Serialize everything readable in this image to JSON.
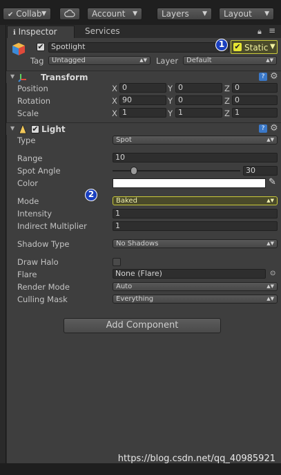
{
  "toolbar": {
    "collab_label": "Collab",
    "account_label": "Account",
    "layers_label": "Layers",
    "layout_label": "Layout"
  },
  "tabs": {
    "inspector": "Inspector",
    "services": "Services"
  },
  "object": {
    "name": "Spotlight",
    "active": true,
    "static_label": "Static",
    "static_checked": true,
    "tag_label": "Tag",
    "tag_value": "Untagged",
    "layer_label": "Layer",
    "layer_value": "Default"
  },
  "transform": {
    "title": "Transform",
    "position_label": "Position",
    "rotation_label": "Rotation",
    "scale_label": "Scale",
    "axis_x": "X",
    "axis_y": "Y",
    "axis_z": "Z",
    "position": [
      "0",
      "0",
      "0"
    ],
    "rotation": [
      "90",
      "0",
      "0"
    ],
    "scale": [
      "1",
      "1",
      "1"
    ]
  },
  "light": {
    "title": "Light",
    "type_label": "Type",
    "type_value": "Spot",
    "range_label": "Range",
    "range_value": "10",
    "spot_angle_label": "Spot Angle",
    "spot_angle_value": "30",
    "spot_angle_fraction": 0.17,
    "color_label": "Color",
    "color_value": "#ffffff",
    "mode_label": "Mode",
    "mode_value": "Baked",
    "intensity_label": "Intensity",
    "intensity_value": "1",
    "indirect_label": "Indirect Multiplier",
    "indirect_value": "1",
    "shadow_label": "Shadow Type",
    "shadow_value": "No Shadows",
    "halo_label": "Draw Halo",
    "flare_label": "Flare",
    "flare_value": "None (Flare)",
    "render_mode_label": "Render Mode",
    "render_mode_value": "Auto",
    "culling_label": "Culling Mask",
    "culling_value": "Everything"
  },
  "add_component_label": "Add Component",
  "badges": {
    "one": "1",
    "two": "2"
  },
  "watermark": "https://blog.csdn.net/qq_40985921",
  "colors": {
    "badge": "#1a3fbf",
    "highlight": "#cbcb3a"
  }
}
